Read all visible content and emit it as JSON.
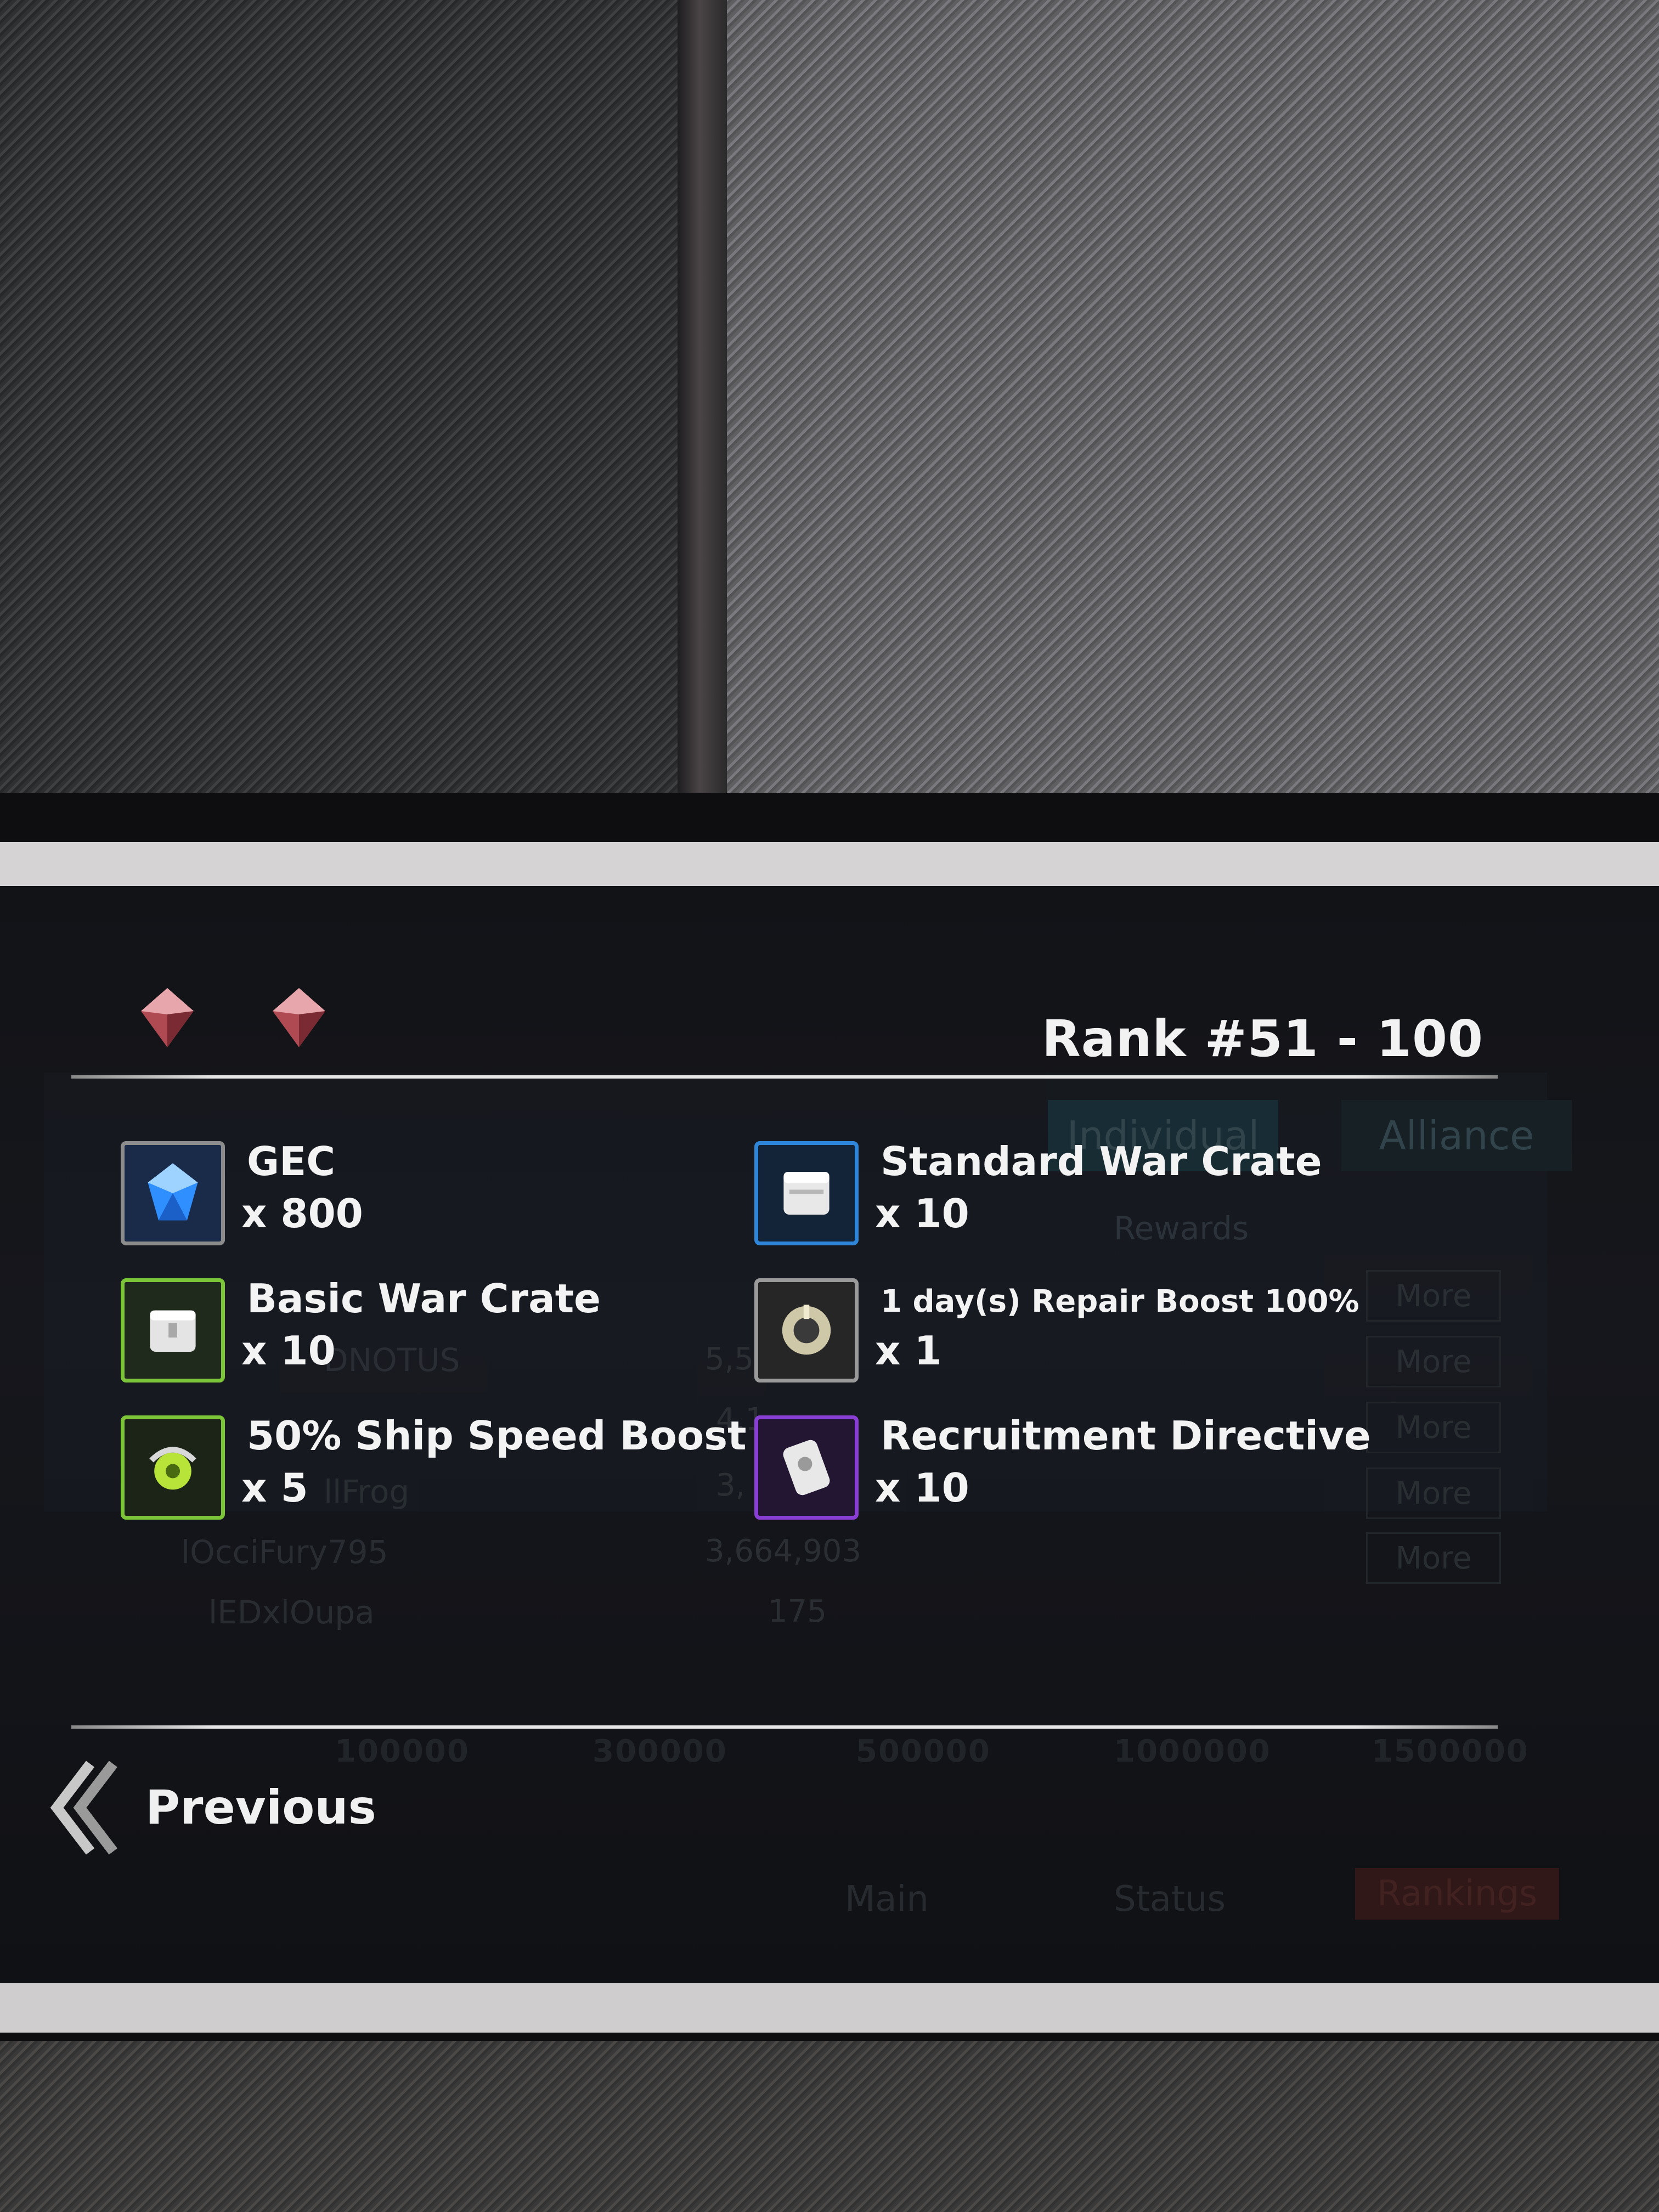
{
  "popup": {
    "rank_title": "Rank #51 - 100",
    "rewards": [
      {
        "name": "GEC",
        "qty": "x 800",
        "icon": "gec-crystal-icon",
        "border": "#8c8c8c"
      },
      {
        "name": "Standard War Crate",
        "qty": "x 10",
        "icon": "standard-war-crate-icon",
        "border": "#2f86d8"
      },
      {
        "name": "Basic War Crate",
        "qty": "x 10",
        "icon": "basic-war-crate-icon",
        "border": "#7cc438"
      },
      {
        "name": "1 day(s) Repair Boost 100%",
        "qty": "x 1",
        "icon": "repair-boost-icon",
        "border": "#9a9a9a"
      },
      {
        "name": "50% Ship Speed Boost",
        "qty": "x 5",
        "icon": "speed-boost-icon",
        "border": "#7cc438"
      },
      {
        "name": "Recruitment Directive",
        "qty": "x 10",
        "icon": "recruitment-directive-icon",
        "border": "#8a3fd4"
      }
    ],
    "previous_label": "Previous"
  },
  "background": {
    "tabs": [
      "Individual",
      "Alliance"
    ],
    "rewards_header": "Rewards",
    "more_label": "More",
    "names": [
      "DNOTUS",
      "llFrog",
      "lOcciFury795",
      "lEDxlOupa"
    ],
    "scores": [
      "5,5",
      "4,1",
      "3,",
      "3,664,903",
      "175"
    ],
    "milestones": [
      "100000",
      "300000",
      "500000",
      "1000000",
      "1500000"
    ],
    "nav": [
      "Main",
      "Status",
      "Rankings"
    ]
  }
}
